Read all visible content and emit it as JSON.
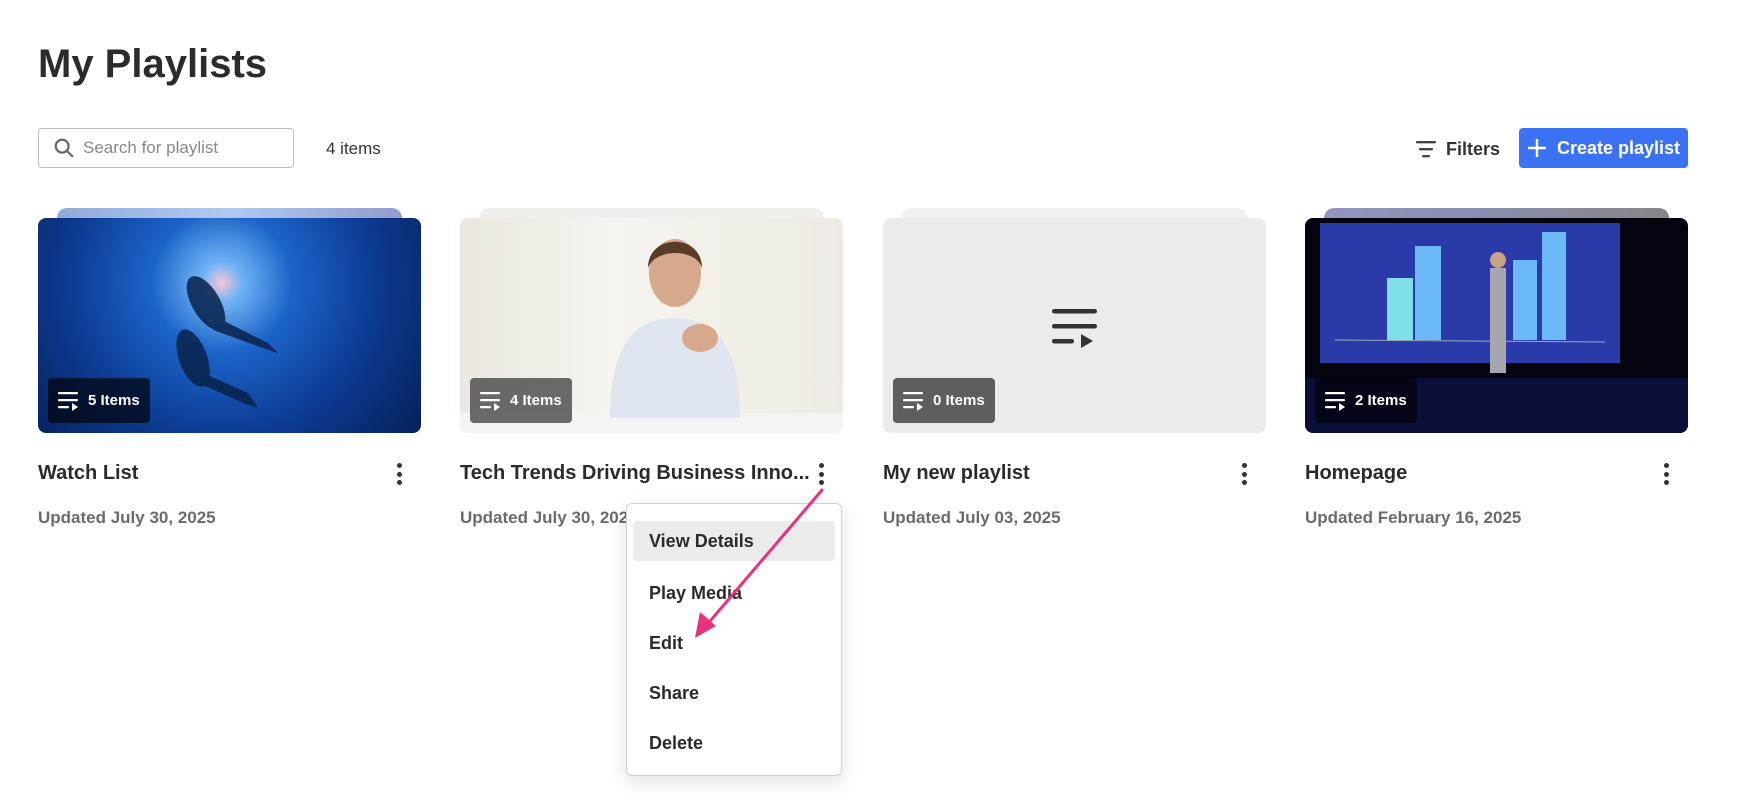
{
  "page": {
    "title": "My Playlists"
  },
  "toolbar": {
    "search_placeholder": "Search for playlist",
    "search_value": "",
    "count": "4 items",
    "filters_label": "Filters",
    "create_label": "Create playlist"
  },
  "colors": {
    "accent": "#3b71f3",
    "annotation_arrow": "#e8327c"
  },
  "playlists": [
    {
      "title": "Watch List",
      "items": "5 Items",
      "updated": "Updated July 30, 2025",
      "thumbnail": "underwater-divers"
    },
    {
      "title": "Tech Trends Driving Business Inno...",
      "items": "4 Items",
      "updated": "Updated July 30, 2025",
      "thumbnail": "smiling-woman"
    },
    {
      "title": "My new playlist",
      "items": "0 Items",
      "updated": "Updated July 03, 2025",
      "thumbnail": "playlist-placeholder-icon"
    },
    {
      "title": "Homepage",
      "items": "2 Items",
      "updated": "Updated February 16, 2025",
      "thumbnail": "presenter-stage"
    }
  ],
  "context_menu": {
    "items": [
      "View Details",
      "Play Media",
      "Edit",
      "Share",
      "Delete"
    ],
    "highlighted": "View Details"
  }
}
